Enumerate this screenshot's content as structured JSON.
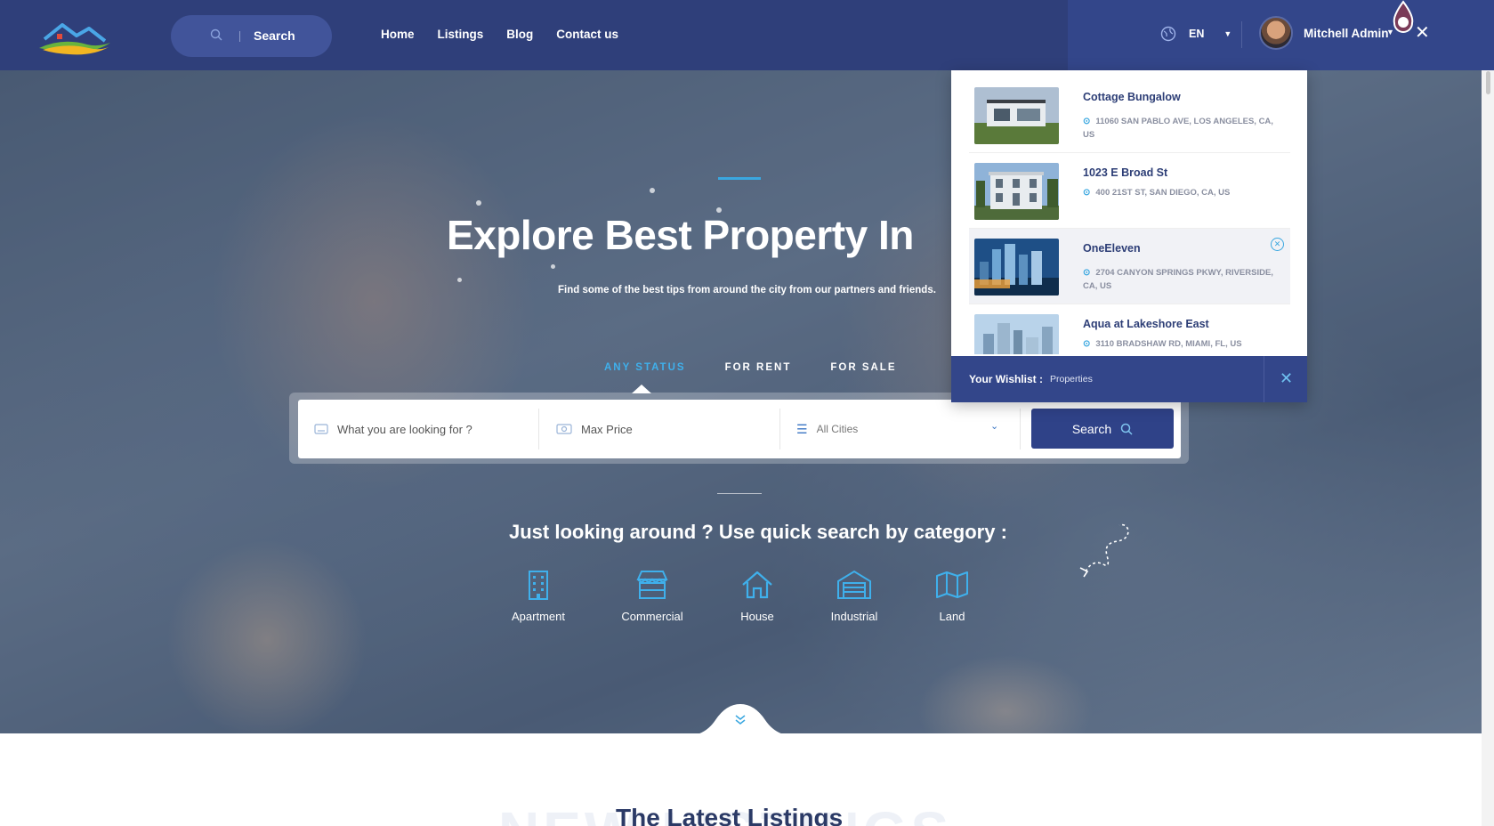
{
  "header": {
    "search_label": "Search",
    "nav": [
      "Home",
      "Listings",
      "Blog",
      "Contact us"
    ],
    "language": "EN",
    "user_name": "Mitchell Admin"
  },
  "hero": {
    "title": "Explore Best Property In",
    "subtitle": "Find some of the best tips from around the city from our partners and friends.",
    "status_tabs": [
      "ANY STATUS",
      "FOR RENT",
      "FOR SALE"
    ],
    "active_tab": "ANY STATUS",
    "search": {
      "keyword_placeholder": "What you are looking for ?",
      "price_placeholder": "Max Price",
      "city_selected": "All Cities",
      "button_label": "Search"
    },
    "quick_search_title": "Just looking around ? Use quick search by category :",
    "categories": [
      {
        "label": "Apartment",
        "icon": "building-icon"
      },
      {
        "label": "Commercial",
        "icon": "store-icon"
      },
      {
        "label": "House",
        "icon": "house-icon"
      },
      {
        "label": "Industrial",
        "icon": "garage-icon"
      },
      {
        "label": "Land",
        "icon": "map-icon"
      }
    ]
  },
  "latest": {
    "title": "The Latest Listings",
    "ghost_text": "NEW LISTINGS"
  },
  "wishlist": {
    "items": [
      {
        "name": "Cottage Bungalow",
        "address": "11060 SAN PABLO AVE, LOS ANGELES, CA, US"
      },
      {
        "name": "1023 E Broad St",
        "address": "400 21ST ST, SAN DIEGO, CA, US"
      },
      {
        "name": "OneEleven",
        "address": "2704 CANYON SPRINGS PKWY, RIVERSIDE, CA, US"
      },
      {
        "name": "Aqua at Lakeshore East",
        "address": "3110 BRADSHAW RD, MIAMI, FL, US"
      }
    ],
    "footer_label": "Your Wishlist :",
    "footer_count": "Properties"
  },
  "colors": {
    "header": "#2f3f7a",
    "accent": "#3aa7e0",
    "button": "#2f4288"
  }
}
